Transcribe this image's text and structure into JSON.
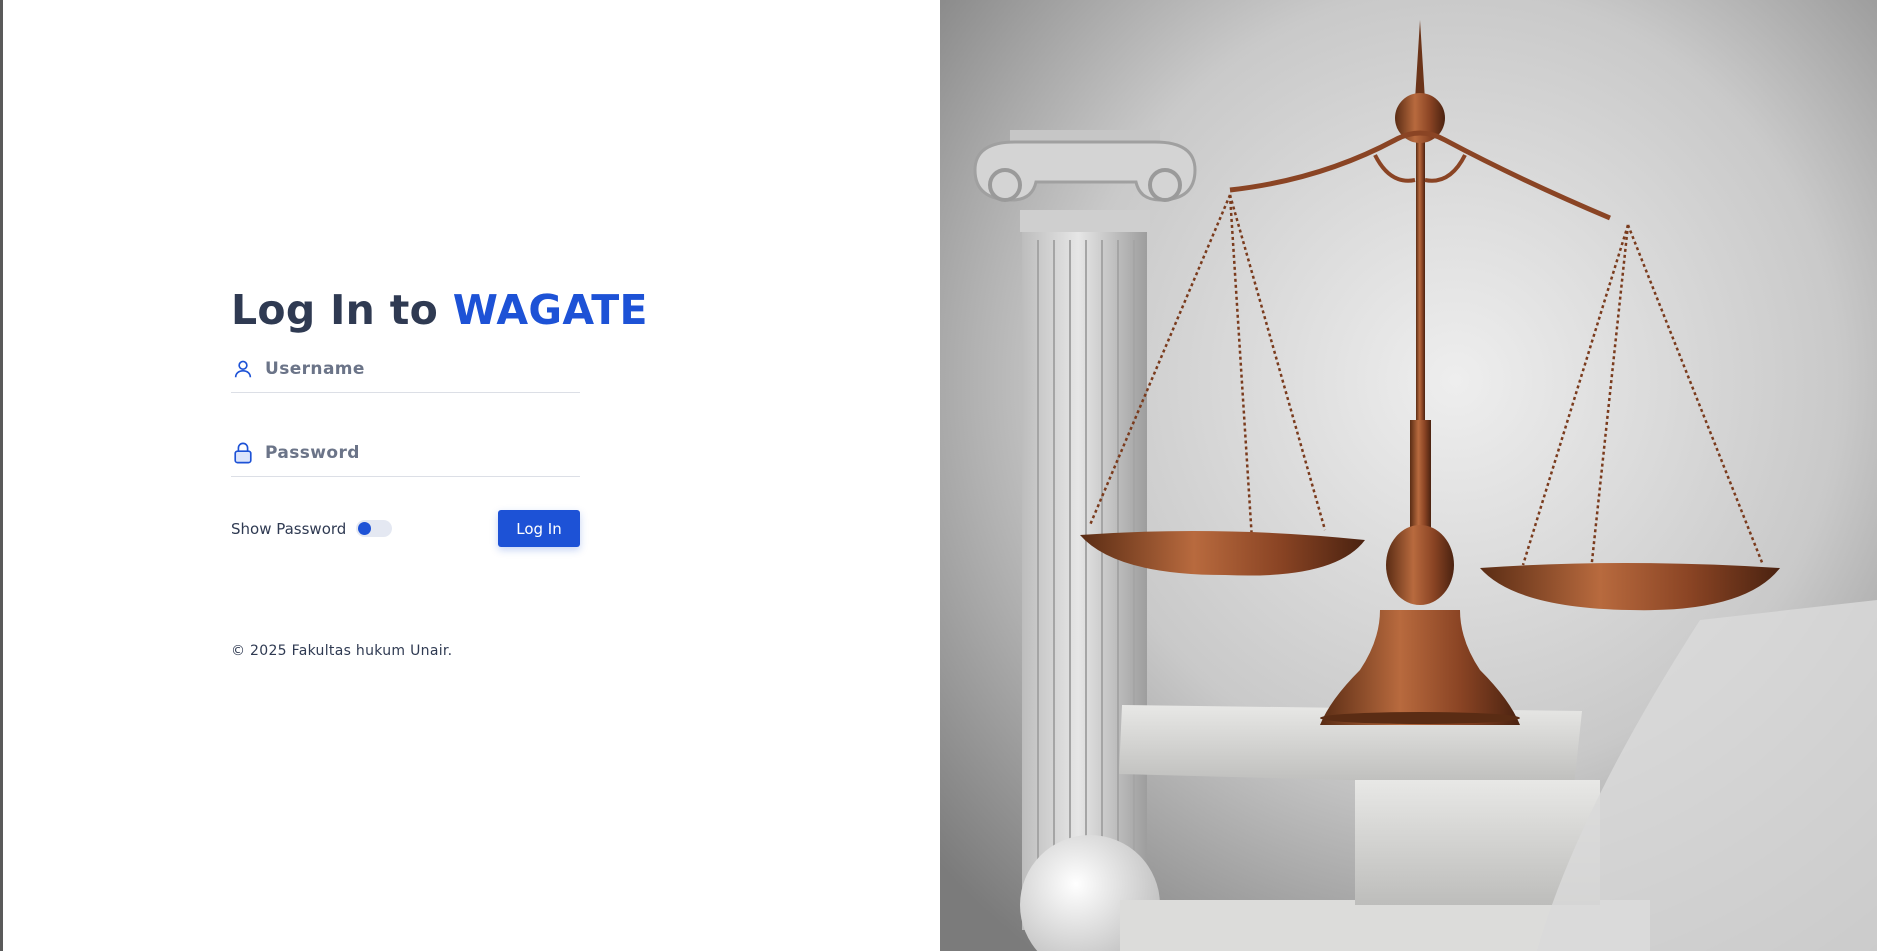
{
  "login": {
    "title_prefix": "Log In to",
    "title_brand": "WAGATE",
    "username_placeholder": "Username",
    "password_placeholder": "Password",
    "show_password_label": "Show Password",
    "show_password_on": true,
    "submit_label": "Log In",
    "footer": "© 2025 Fakultas hukum Unair."
  },
  "icons": {
    "username": "user-icon",
    "password": "lock-icon"
  },
  "colors": {
    "accent": "#1d52d6",
    "text": "#2f3a52",
    "placeholder": "#6b7488",
    "divider": "#dcdfe6"
  }
}
